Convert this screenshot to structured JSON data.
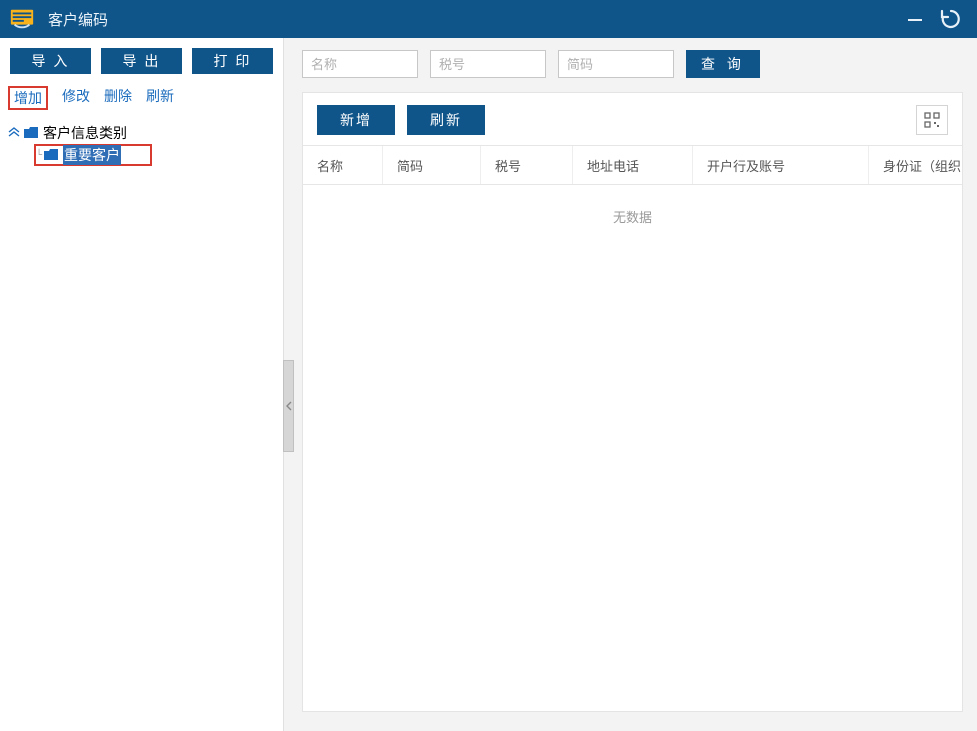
{
  "title": "客户编码",
  "colors": {
    "primary": "#10558a",
    "highlight": "#d93a2f",
    "link": "#1a6bbd",
    "selected_bg": "#2f6eb5"
  },
  "left_toolbar": {
    "import": "导 入",
    "export": "导 出",
    "print": "打 印"
  },
  "tree_actions": {
    "add": "增加",
    "edit": "修改",
    "delete": "删除",
    "refresh": "刷新"
  },
  "tree": {
    "root_label": "客户信息类别",
    "child_label": "重要客户"
  },
  "filters": {
    "name_placeholder": "名称",
    "tax_placeholder": "税号",
    "code_placeholder": "简码",
    "search_label": "查 询"
  },
  "card_actions": {
    "add": "新增",
    "refresh": "刷新"
  },
  "columns": {
    "name": "名称",
    "code": "简码",
    "tax": "税号",
    "addr": "地址电话",
    "bank": "开户行及账号",
    "idcard": "身份证（组织"
  },
  "nodata": "无数据"
}
